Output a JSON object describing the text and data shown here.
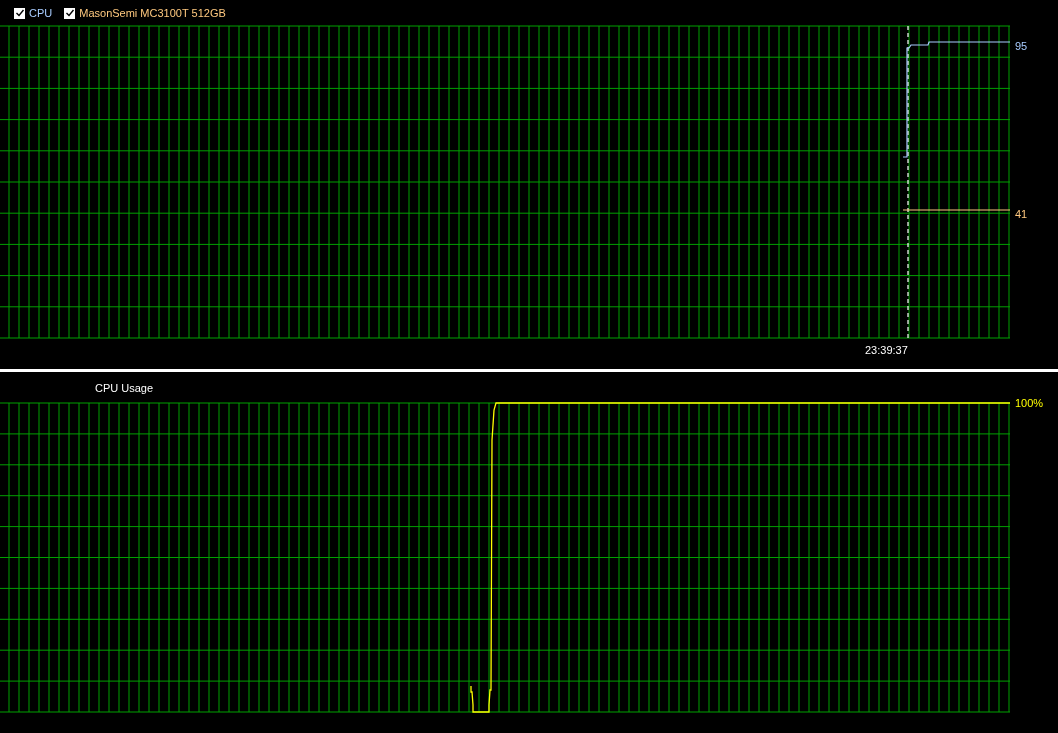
{
  "legend": [
    {
      "label": "CPU",
      "checked": true,
      "color": "#a8ccff"
    },
    {
      "label": "MasonSemi MC3100T 512GB",
      "checked": true,
      "color": "#ffc97f"
    }
  ],
  "top_graph": {
    "readings": [
      "95",
      "41"
    ],
    "cursor_time": "23:39:37"
  },
  "bottom_graph": {
    "title": "CPU Usage",
    "reading": "100%"
  }
}
